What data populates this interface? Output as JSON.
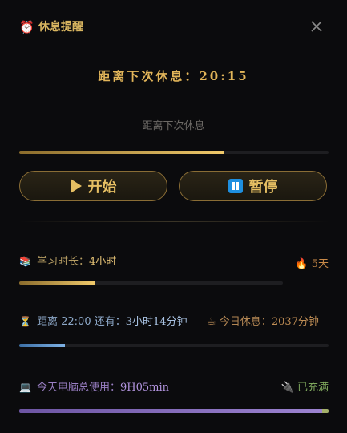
{
  "window": {
    "title": "休息提醒",
    "icon": "alarm-clock-icon"
  },
  "countdown": {
    "label": "距离下次休息：20:15"
  },
  "subtitle": "距离下次休息",
  "main_progress": {
    "fraction": 0.66
  },
  "buttons": {
    "start_label": "开始",
    "pause_label": "暂停"
  },
  "study": {
    "label": "学习时长：",
    "value": "4小时",
    "streak": "5天",
    "progress_fraction": 0.285
  },
  "time_left": {
    "label": "距离 22:00 还有：",
    "value": "3小时14分钟",
    "progress_fraction": 0.148
  },
  "rest_today": {
    "label": "今日休息：",
    "value": "2037分钟"
  },
  "pc_usage": {
    "label": "今天电脑总使用：",
    "value": "9H05min",
    "battery": "已充满",
    "progress_fraction": 0.98
  }
}
